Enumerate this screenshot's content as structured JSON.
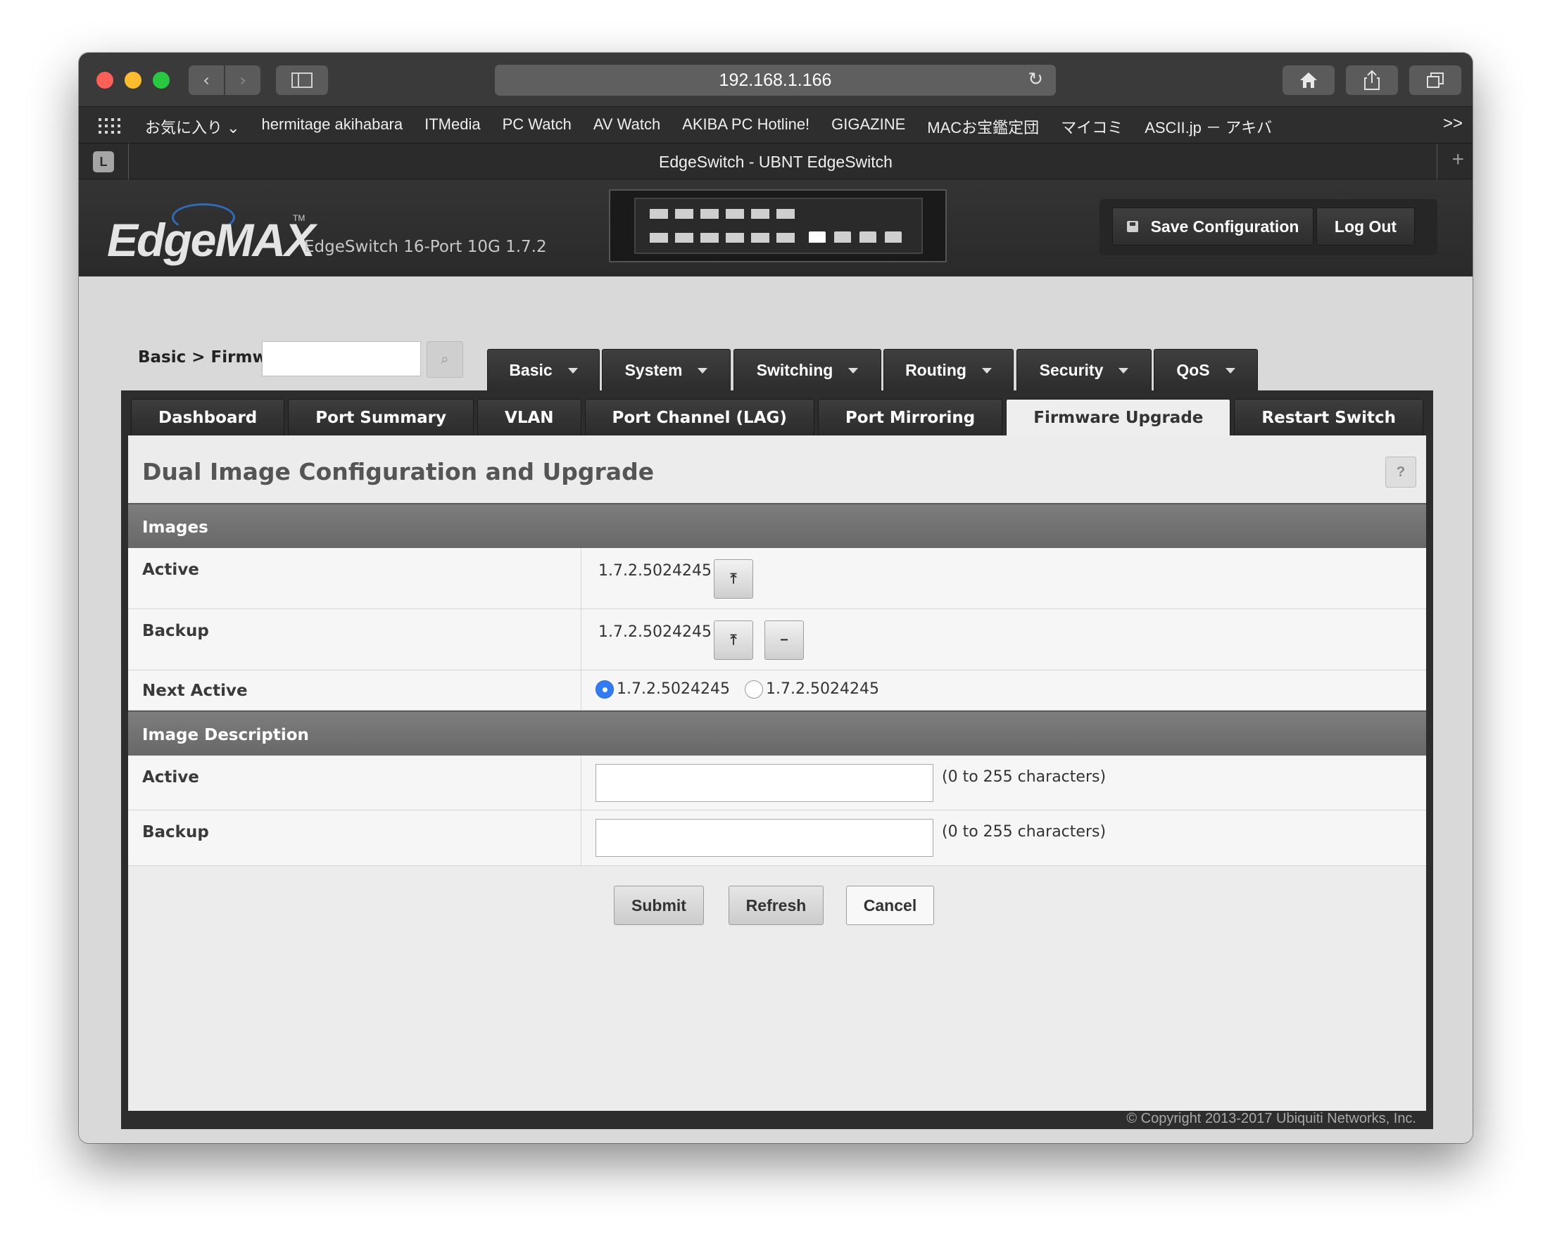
{
  "browser": {
    "address": "192.168.1.166",
    "favorites": [
      "お気に入り ⌄",
      "hermitage akihabara",
      "ITMedia",
      "PC Watch",
      "AV Watch",
      "AKIBA PC Hotline!",
      "GIGAZINE",
      "MACお宝鑑定団",
      "マイコミ",
      "ASCII.jp － アキバ"
    ],
    "favorites_more": ">>",
    "tab_badge": "L",
    "tab_title": "EdgeSwitch - UBNT EdgeSwitch",
    "new_tab": "+"
  },
  "header": {
    "logo": "EdgeMAX",
    "logo_tm": "TM",
    "device_name": "EdgeSwitch 16-Port 10G 1.7.2",
    "save_label": "Save Configuration",
    "logout_label": "Log Out"
  },
  "breadcrumb": "Basic > Firmwa",
  "menu": [
    "Basic",
    "System",
    "Switching",
    "Routing",
    "Security",
    "QoS"
  ],
  "subtabs": [
    "Dashboard",
    "Port Summary",
    "VLAN",
    "Port Channel (LAG)",
    "Port Mirroring",
    "Firmware Upgrade",
    "Restart Switch"
  ],
  "active_subtab": "Firmware Upgrade",
  "content": {
    "title": "Dual Image Configuration and Upgrade",
    "help": "?",
    "images_section": "Images",
    "active_label": "Active",
    "active_version": "1.7.2.5024245",
    "backup_label": "Backup",
    "backup_version": "1.7.2.5024245",
    "next_active_label": "Next Active",
    "next_active_option1": "1.7.2.5024245",
    "next_active_option2": "1.7.2.5024245",
    "next_active_selected": 1,
    "description_section": "Image Description",
    "desc_active_label": "Active",
    "desc_active_value": "",
    "desc_active_hint": "(0 to 255 characters)",
    "desc_backup_label": "Backup",
    "desc_backup_value": "",
    "desc_backup_hint": "(0 to 255 characters)"
  },
  "actions": {
    "submit": "Submit",
    "refresh": "Refresh",
    "cancel": "Cancel"
  },
  "footer": "© Copyright 2013-2017 Ubiquiti Networks, Inc.",
  "colors": {
    "accent": "#2f7cf6",
    "header_bg": "#2d2d2d",
    "section_bg": "#6f6f6f"
  }
}
